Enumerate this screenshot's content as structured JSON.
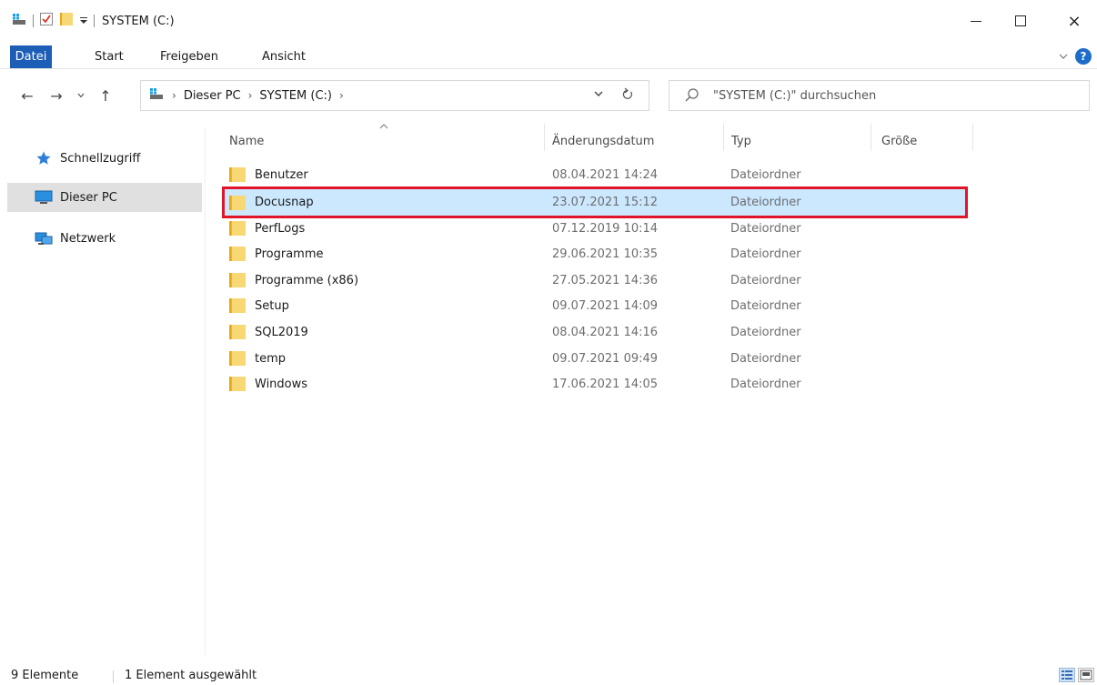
{
  "window": {
    "title": "SYSTEM (C:)",
    "minimize": "minimize",
    "maximize": "maximize",
    "close": "×"
  },
  "ribbon": {
    "tabs": [
      {
        "label": "Datei"
      },
      {
        "label": "Start"
      },
      {
        "label": "Freigeben"
      },
      {
        "label": "Ansicht"
      }
    ],
    "help": "?"
  },
  "nav": {
    "back": "←",
    "forward": "→",
    "recent": "⌄",
    "up": "↑"
  },
  "address": {
    "breadcrumb": [
      "Dieser PC",
      "SYSTEM (C:)"
    ],
    "separator": "›"
  },
  "search": {
    "placeholder": "\"SYSTEM (C:)\" durchsuchen"
  },
  "navpane": {
    "items": [
      {
        "label": "Schnellzugriff",
        "icon": "star-icon"
      },
      {
        "label": "Dieser PC",
        "icon": "computer-icon",
        "selected": true
      },
      {
        "label": "Netzwerk",
        "icon": "network-icon"
      }
    ]
  },
  "columns": {
    "name": "Name",
    "date": "Änderungsdatum",
    "type": "Typ",
    "size": "Größe"
  },
  "files": [
    {
      "name": "Benutzer",
      "date": "08.04.2021 14:24",
      "type": "Dateiordner"
    },
    {
      "name": "Docusnap",
      "date": "23.07.2021 15:12",
      "type": "Dateiordner",
      "selected": true
    },
    {
      "name": "PerfLogs",
      "date": "07.12.2019 10:14",
      "type": "Dateiordner"
    },
    {
      "name": "Programme",
      "date": "29.06.2021 10:35",
      "type": "Dateiordner"
    },
    {
      "name": "Programme (x86)",
      "date": "27.05.2021 14:36",
      "type": "Dateiordner"
    },
    {
      "name": "Setup",
      "date": "09.07.2021 14:09",
      "type": "Dateiordner"
    },
    {
      "name": "SQL2019",
      "date": "08.04.2021 14:16",
      "type": "Dateiordner"
    },
    {
      "name": "temp",
      "date": "09.07.2021 09:49",
      "type": "Dateiordner"
    },
    {
      "name": "Windows",
      "date": "17.06.2021 14:05",
      "type": "Dateiordner"
    }
  ],
  "status": {
    "count": "9 Elemente",
    "selection": "1 Element ausgewählt"
  },
  "colors": {
    "accent": "#1c5db5",
    "selection_bg": "#cce8ff",
    "highlight_border": "#e0152a"
  }
}
